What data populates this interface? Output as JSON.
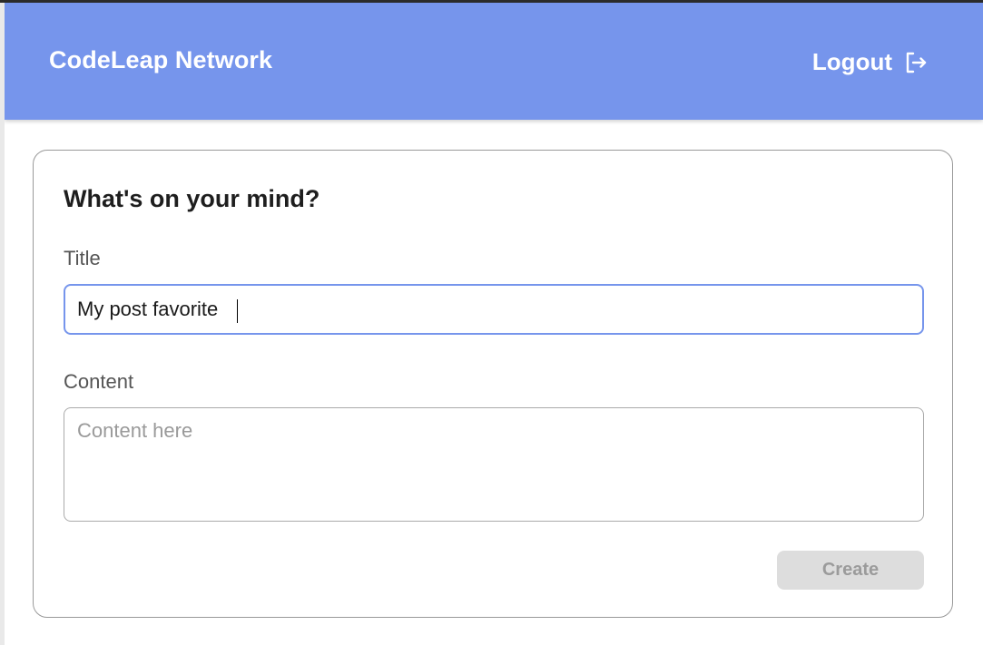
{
  "header": {
    "brand": "CodeLeap Network",
    "logout_label": "Logout",
    "logout_icon": "logout-icon",
    "background": "#7695ec"
  },
  "form": {
    "heading": "What's on your mind?",
    "title_label": "Title",
    "title_value": "My post favorite",
    "content_label": "Content",
    "content_placeholder": "Content here",
    "content_value": "",
    "create_label": "Create",
    "create_disabled": true
  }
}
